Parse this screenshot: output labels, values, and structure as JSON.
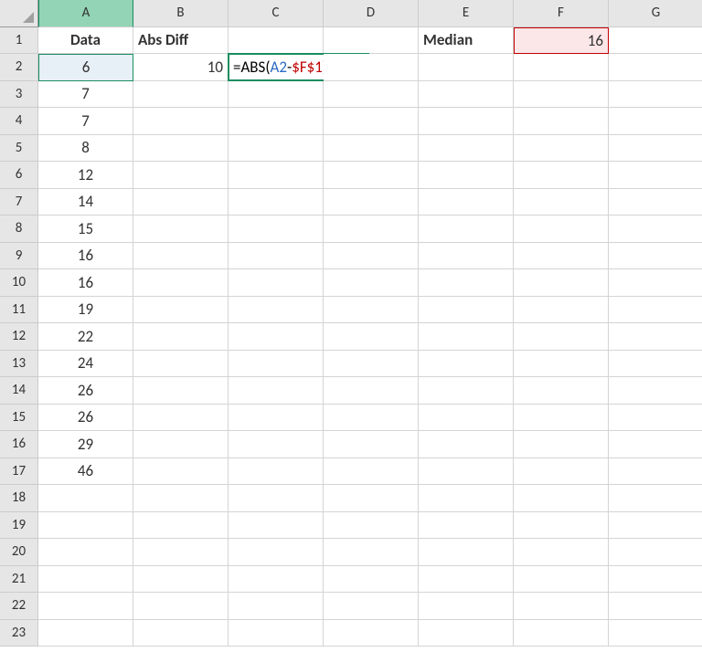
{
  "columns": [
    "A",
    "B",
    "C",
    "D",
    "E",
    "F",
    "G"
  ],
  "rows": [
    "1",
    "2",
    "3",
    "4",
    "5",
    "6",
    "7",
    "8",
    "9",
    "10",
    "11",
    "12",
    "13",
    "14",
    "15",
    "16",
    "17",
    "18",
    "19",
    "20",
    "21",
    "22",
    "23"
  ],
  "header_row": {
    "A": "Data",
    "B": "Abs Diff",
    "E": "Median",
    "F": "16"
  },
  "dataA": [
    "6",
    "7",
    "7",
    "8",
    "12",
    "14",
    "15",
    "16",
    "16",
    "19",
    "22",
    "24",
    "26",
    "26",
    "29",
    "46"
  ],
  "B2": "10",
  "editing_cell": "C2",
  "formula": {
    "eq": "=",
    "fn": "ABS",
    "open": "(",
    "ref1": "A2",
    "op": "-",
    "ref2": "$F$1",
    "close": ")"
  },
  "selected_column": "A",
  "selected_cell": "A2",
  "highlighted_cell": "F1"
}
